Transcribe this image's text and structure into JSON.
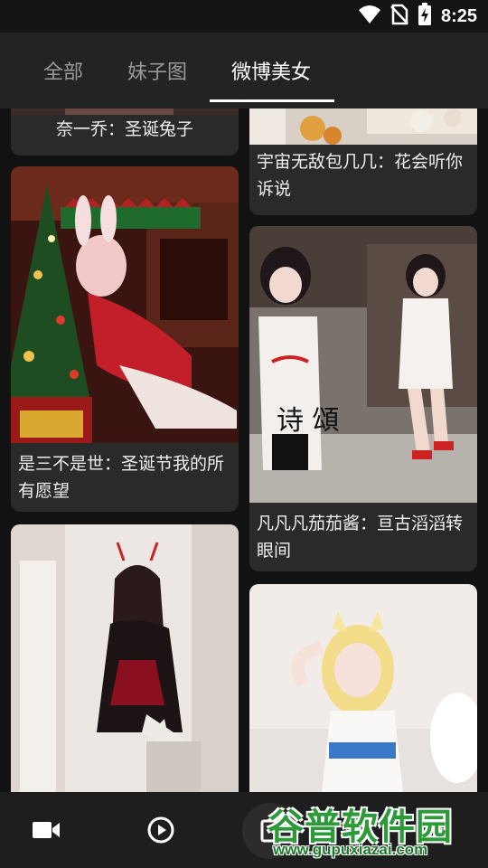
{
  "status_bar": {
    "time": "8:25",
    "icons": [
      "wifi-icon",
      "no-sim-icon",
      "battery-charging-icon"
    ]
  },
  "tabs": [
    {
      "label": "全部",
      "active": false
    },
    {
      "label": "妹子图",
      "active": false
    },
    {
      "label": "微博美女",
      "active": true
    }
  ],
  "feed": {
    "left": [
      {
        "title": "奈一乔：圣诞兔子",
        "image": "christmas-bunny-cosplay-photo"
      },
      {
        "title": "是三不是世：圣诞节我的所有愿望",
        "image": "christmas-tree-cosplay-photo"
      },
      {
        "title": "",
        "image": "gothic-dress-cosplay-photo"
      }
    ],
    "right": [
      {
        "title": "宇宙无敌包几几：花会听你诉说",
        "image": "flowers-photo"
      },
      {
        "title": "凡凡凡茄茄酱：亘古滔滔转眼间",
        "image": "qipao-cosplay-photo"
      },
      {
        "title": "",
        "image": "catgirl-cosplay-photo"
      }
    ]
  },
  "bottom_nav": {
    "items": [
      "video-camera-icon",
      "play-circle-icon",
      "image-icon"
    ]
  },
  "watermark": {
    "title": "谷普软件园",
    "url": "www.gupuxiazai.com"
  },
  "colors": {
    "background": "#121212",
    "card": "#2a2a2a",
    "tab_bar": "#232323",
    "watermark_green": "#2d9a3a"
  }
}
